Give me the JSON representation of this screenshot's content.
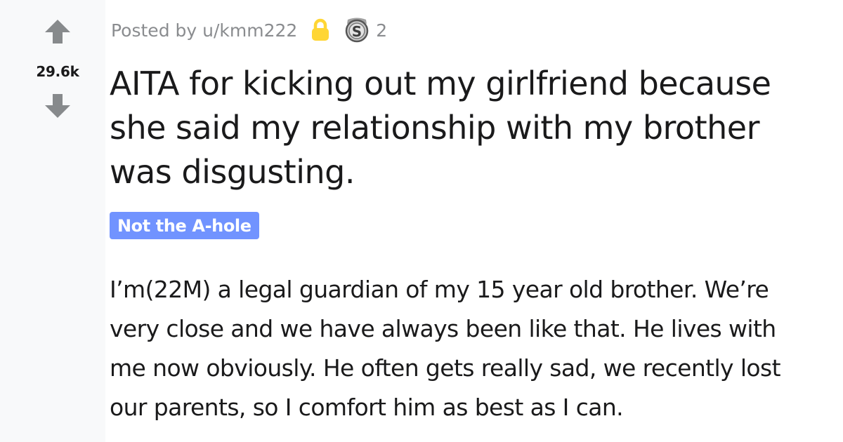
{
  "vote": {
    "score": "29.6k",
    "upvote_icon": "upvote-arrow-icon",
    "downvote_icon": "downvote-arrow-icon"
  },
  "meta": {
    "posted_by": "Posted by u/kmm222",
    "lock_icon": "lock-icon",
    "award_icon": "silver-award-icon",
    "award_count": "2"
  },
  "post": {
    "title": "AITA for kicking out my girlfriend because she said my relationship with my brother was disgusting.",
    "flair": "Not the A-hole",
    "body": "I’m(22M) a legal guardian of my 15 year old brother. We’re very close and we have always been like that. He lives with me now obviously. He often gets really sad, we recently lost our parents, so I comfort him as best as I can."
  },
  "colors": {
    "flair_bg": "#7193ff",
    "vote_arrow": "#878a8c",
    "lock": "#ffd635",
    "text": "#1a1a1b",
    "meta_text": "#8a8c8f"
  }
}
